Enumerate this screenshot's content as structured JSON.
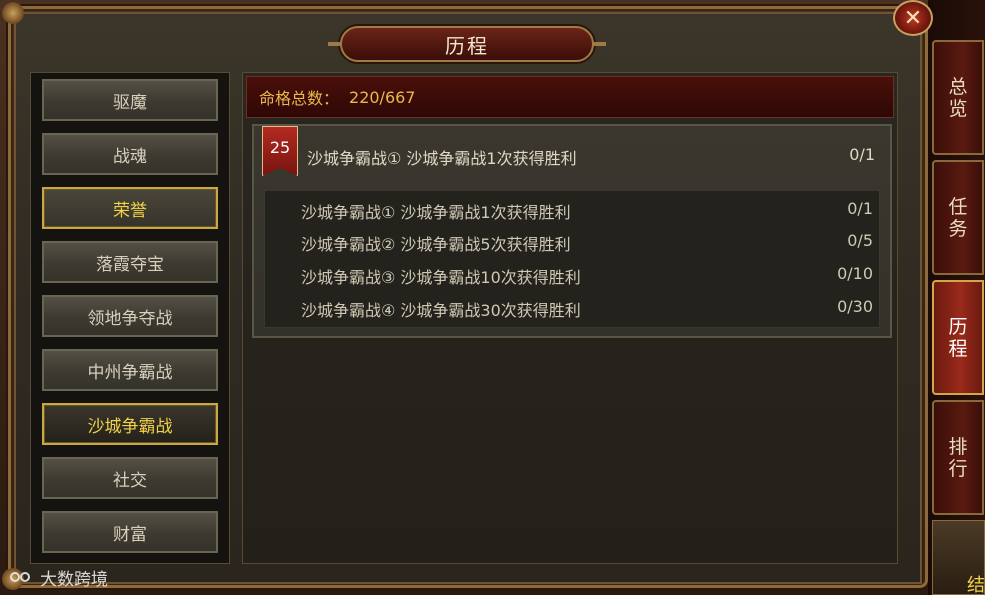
{
  "dialog": {
    "title": "历程",
    "close_icon": "close-icon"
  },
  "categories": [
    {
      "label": "驱魔",
      "state": "normal"
    },
    {
      "label": "战魂",
      "state": "normal"
    },
    {
      "label": "荣誉",
      "state": "selected"
    },
    {
      "label": "落霞夺宝",
      "state": "normal"
    },
    {
      "label": "领地争夺战",
      "state": "normal"
    },
    {
      "label": "中州争霸战",
      "state": "normal"
    },
    {
      "label": "沙城争霸战",
      "state": "active"
    },
    {
      "label": "社交",
      "state": "normal"
    },
    {
      "label": "财富",
      "state": "normal"
    }
  ],
  "summary": {
    "label": "命格总数：",
    "value": "220/667"
  },
  "achievement": {
    "level": "25",
    "title": "沙城争霸战① 沙城争霸战1次获得胜利",
    "progress": "0/1",
    "sub_items": [
      {
        "label": "沙城争霸战① 沙城争霸战1次获得胜利",
        "progress": "0/1"
      },
      {
        "label": "沙城争霸战② 沙城争霸战5次获得胜利",
        "progress": "0/5"
      },
      {
        "label": "沙城争霸战③ 沙城争霸战10次获得胜利",
        "progress": "0/10"
      },
      {
        "label": "沙城争霸战④ 沙城争霸战30次获得胜利",
        "progress": "0/30"
      }
    ]
  },
  "side_tabs": [
    {
      "label_1": "总",
      "label_2": "览",
      "active": false
    },
    {
      "label_1": "任",
      "label_2": "务",
      "active": false
    },
    {
      "label_1": "历",
      "label_2": "程",
      "active": true
    },
    {
      "label_1": "排",
      "label_2": "行",
      "active": false
    }
  ],
  "corner_tab": {
    "label": "结"
  },
  "watermark": {
    "text": "大数跨境"
  },
  "colors": {
    "gold_text": "#f2d24a",
    "accent_red": "#9a2a1a",
    "summary_text": "#e8b84a"
  }
}
